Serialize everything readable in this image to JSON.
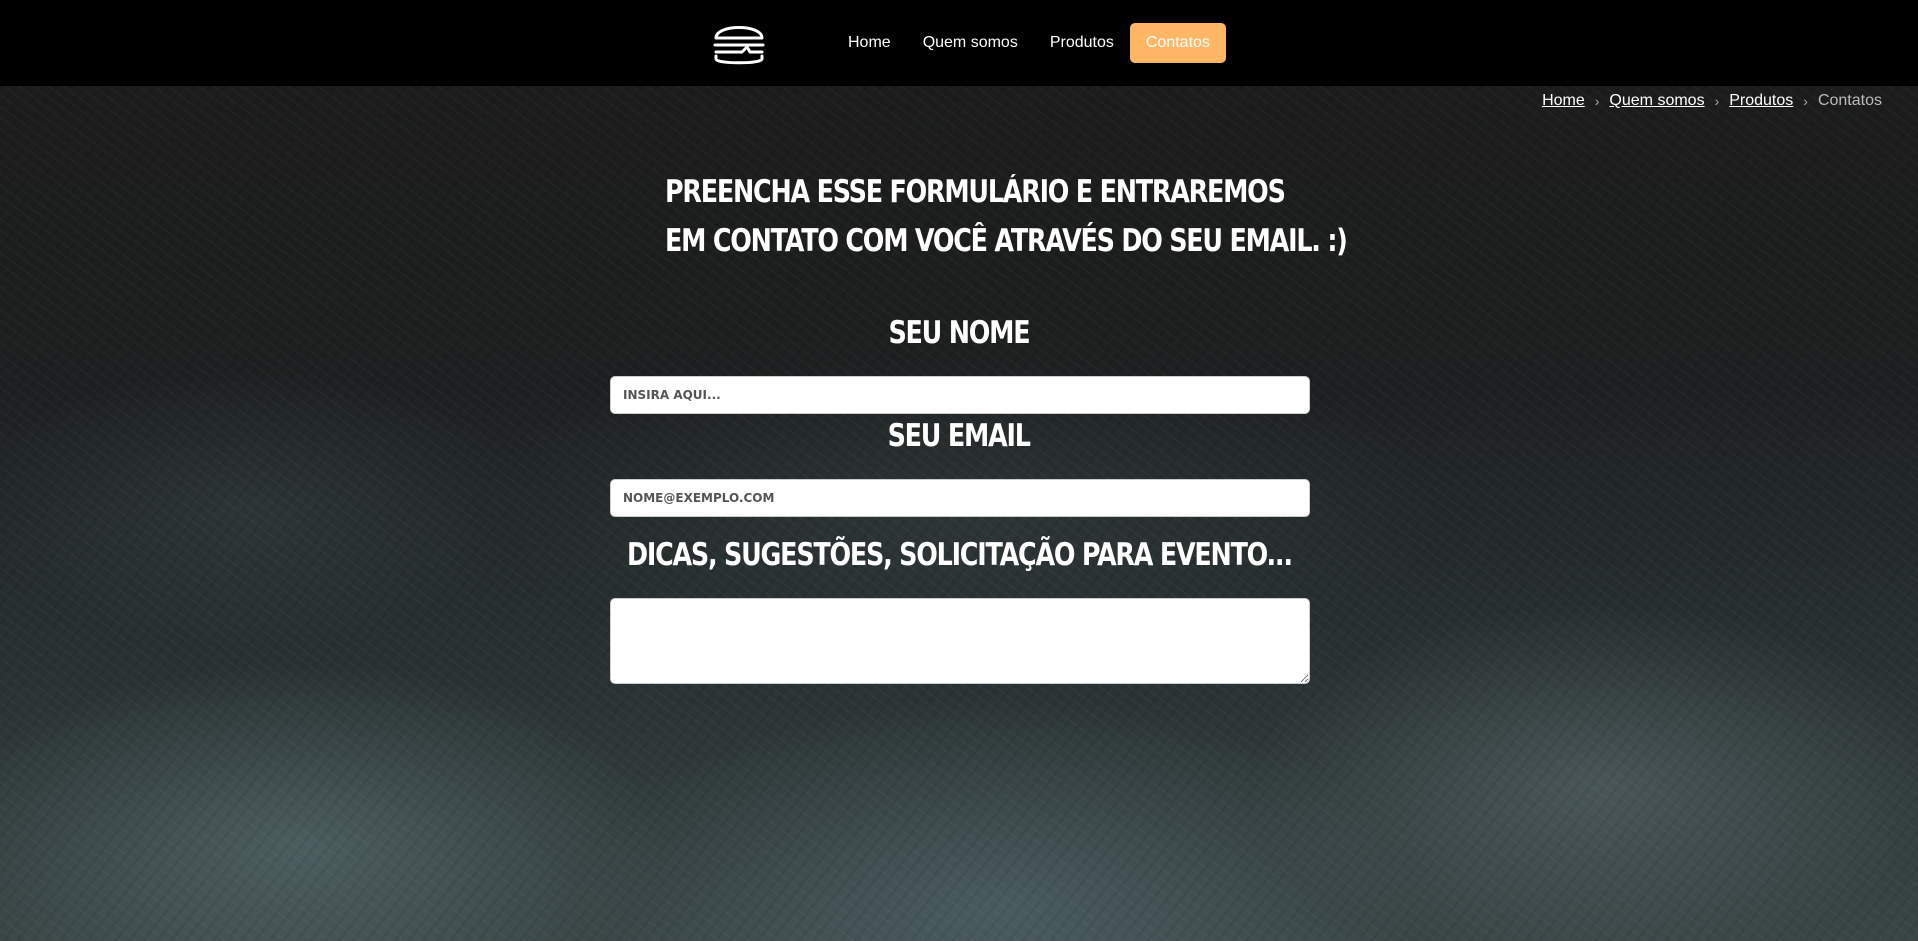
{
  "nav": {
    "logo_icon": "burger-icon",
    "items": [
      {
        "label": "Home"
      },
      {
        "label": "Quem somos"
      },
      {
        "label": "Produtos"
      },
      {
        "label": "Contatos",
        "active": true
      }
    ],
    "active_color": "#ffb765"
  },
  "breadcrumb": {
    "items": [
      "Home",
      "Quem somos",
      "Produtos"
    ],
    "current": "Contatos"
  },
  "form": {
    "heading_line1": "Preencha esse formulário e entraremos",
    "heading_line2": "em contato com você através do seu email. :)",
    "name_label": "Seu nome",
    "name_placeholder": "Insira aqui...",
    "email_label": "Seu email",
    "email_placeholder": "nome@exemplo.com",
    "message_label": "Dicas, sugestões, solicitação para evento...",
    "message_placeholder": ""
  }
}
